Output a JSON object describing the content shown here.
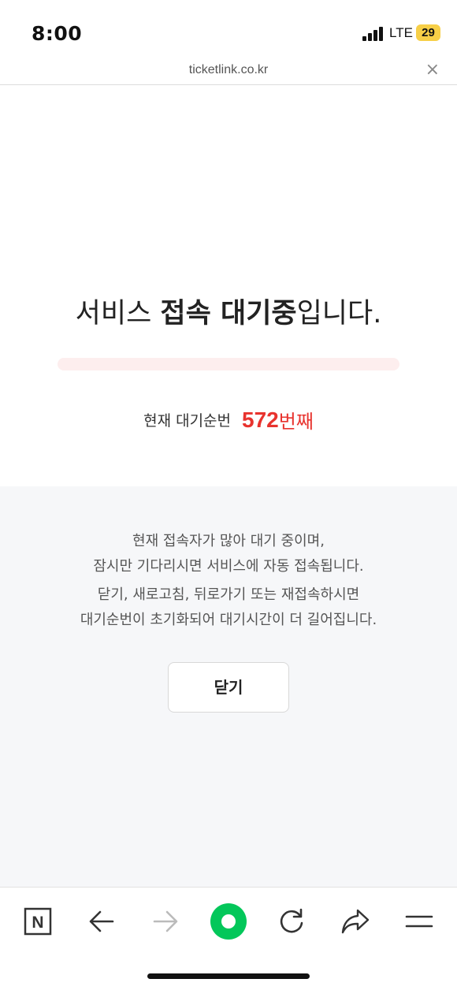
{
  "status_bar": {
    "time": "8:00",
    "network": "LTE",
    "battery": "29"
  },
  "url_bar": {
    "domain": "ticketlink.co.kr",
    "close_glyph": "×"
  },
  "main": {
    "headline_prefix": "서비스 ",
    "headline_bold": "접속 대기중",
    "headline_suffix": "입니다.",
    "progress_fraction": 0.0,
    "queue_label": "현재 대기순번",
    "queue_number": "572",
    "queue_suffix": "번째"
  },
  "info": {
    "line1": "현재 접속자가 많아 대기 중이며,",
    "line2": "잠시만 기다리시면 서비스에 자동 접속됩니다.",
    "line3": "닫기, 새로고침, 뒤로가기 또는 재접속하시면",
    "line4": "대기순번이 초기화되어 대기시간이 더 길어집니다.",
    "close_button": "닫기"
  },
  "toolbar": {
    "items": [
      "naver-home-icon",
      "back-arrow-icon",
      "forward-arrow-icon",
      "green-dot-icon",
      "refresh-icon",
      "share-icon",
      "menu-icon"
    ],
    "naver_letter": "N"
  },
  "colors": {
    "accent_red": "#e8332e",
    "green": "#03c75a",
    "progress_track": "#fdeeee"
  }
}
